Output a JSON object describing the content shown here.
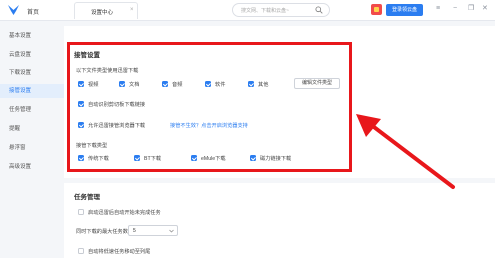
{
  "topbar": {
    "home_label": "首页",
    "active_tab_label": "设置中心",
    "tab_close": "×",
    "search_placeholder": "搜文网、下载和云盘~",
    "login_label": "登录领云盘",
    "menu_glyph": "≡",
    "minimize_glyph": "−",
    "restore_glyph": "❐",
    "close_glyph": "✕"
  },
  "sidebar": {
    "items": [
      {
        "label": "基本设置",
        "active": false
      },
      {
        "label": "云盘设置",
        "active": false
      },
      {
        "label": "下载设置",
        "active": false
      },
      {
        "label": "接管设置",
        "active": true
      },
      {
        "label": "任务管理",
        "active": false
      },
      {
        "label": "提醒",
        "active": false
      },
      {
        "label": "悬浮窗",
        "active": false
      },
      {
        "label": "高级设置",
        "active": false
      }
    ]
  },
  "takeover": {
    "title": "接管设置",
    "filetypes_label": "以下文件类型使用迅雷下载",
    "types": [
      {
        "label": "视频",
        "checked": true
      },
      {
        "label": "文档",
        "checked": true
      },
      {
        "label": "音频",
        "checked": true
      },
      {
        "label": "软件",
        "checked": true
      },
      {
        "label": "其他",
        "checked": true
      }
    ],
    "edit_button": "编辑文件类型",
    "clipboard_label": "自动识别剪切板下载链接",
    "clipboard_checked": true,
    "browser_label": "允许迅雷接管浏览器下载",
    "browser_checked": true,
    "browser_link": "接管不生效？点击开启浏览器支持",
    "protocols_label": "接管下载类型",
    "protocols": [
      {
        "label": "传统下载",
        "checked": true
      },
      {
        "label": "BT下载",
        "checked": true
      },
      {
        "label": "eMule下载",
        "checked": true
      },
      {
        "label": "磁力链接下载",
        "checked": true
      }
    ]
  },
  "tasks": {
    "title": "任务管理",
    "auto_start_label": "启动迅雷后自动开始未完成任务",
    "auto_start_checked": false,
    "max_tasks_label": "同时下载的最大任务数",
    "max_tasks_value": "5",
    "auto_move_label": "自动将低速任务移动至列尾",
    "auto_move_checked": false
  },
  "colors": {
    "accent": "#2b7df0",
    "annotation": "#e8171b"
  }
}
